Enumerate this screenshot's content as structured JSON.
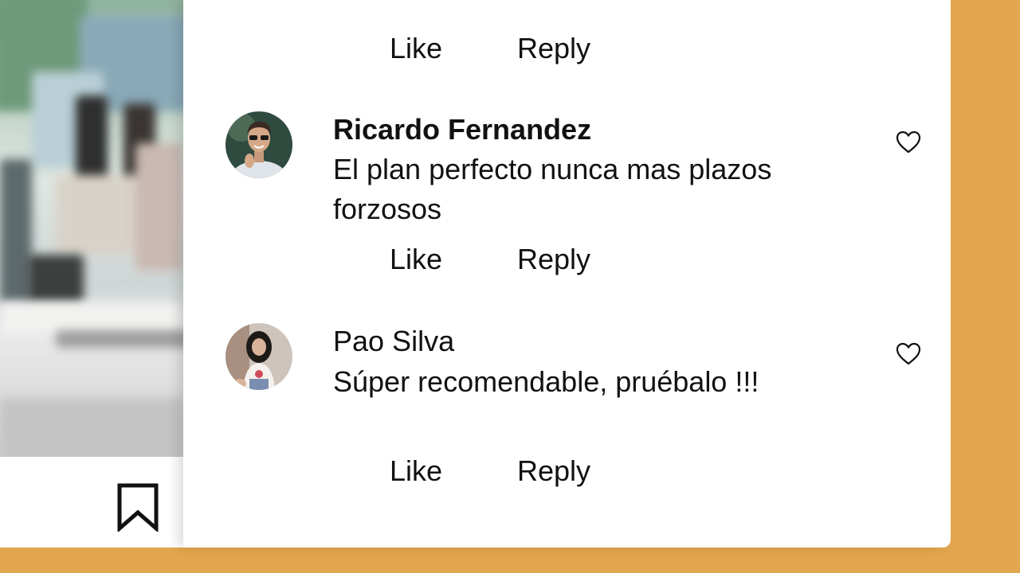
{
  "comments": [
    {
      "author": "Ricardo Fernandez",
      "text": "El plan perfecto nunca mas plazos forzosos",
      "like_label": "Like",
      "reply_label": "Reply",
      "heart_icon": "heart-outline-icon"
    },
    {
      "author": "Pao Silva",
      "text": "Súper recomendable, pruébalo !!!",
      "like_label": "Like",
      "reply_label": "Reply",
      "heart_icon": "heart-outline-icon"
    }
  ],
  "previous_comment_actions": {
    "like_label": "Like",
    "reply_label": "Reply"
  },
  "icons": {
    "save": "bookmark-icon"
  },
  "colors": {
    "background": "#E2A64E",
    "panel": "#FFFFFF",
    "text": "#111111"
  }
}
